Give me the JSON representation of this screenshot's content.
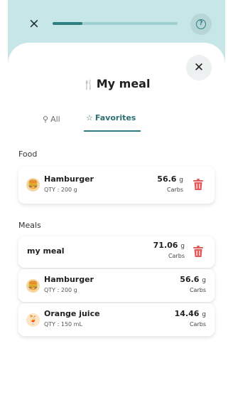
{
  "progress": {
    "label": "×",
    "fraction": 0.24
  },
  "help": {
    "glyph": "?"
  },
  "sheet": {
    "close_glyph": "✕"
  },
  "title": {
    "icon": "fork-knife-icon",
    "text": "My meal"
  },
  "tabs": [
    {
      "icon": "search-icon",
      "label": "All"
    },
    {
      "icon": "star-icon",
      "label": "Favorites",
      "selected": true
    }
  ],
  "food": {
    "header": "Food",
    "items": [
      {
        "icon": "hamburger-icon",
        "name": "Hamburger",
        "qty": "QTY : 200 g",
        "value": "56.6",
        "unit": "g",
        "carbs": "Carbs"
      }
    ]
  },
  "meals": {
    "header": "Meals",
    "meal": {
      "name": "my meal",
      "value": "71.06",
      "unit": "g",
      "carbs": "Carbs",
      "items": [
        {
          "icon": "hamburger-icon",
          "name": "Hamburger",
          "qty": "QTY : 200 g",
          "value": "56.6",
          "unit": "g",
          "carbs": "Carbs"
        },
        {
          "icon": "orange-juice-icon",
          "name": "Orange juice",
          "qty": "QTY : 150 mL",
          "value": "14.46",
          "unit": "g",
          "carbs": "Carbs"
        }
      ]
    }
  },
  "colors": {
    "accent": "#2f7f82",
    "background": "#c7e6e7",
    "delete": "#e05a5a"
  }
}
